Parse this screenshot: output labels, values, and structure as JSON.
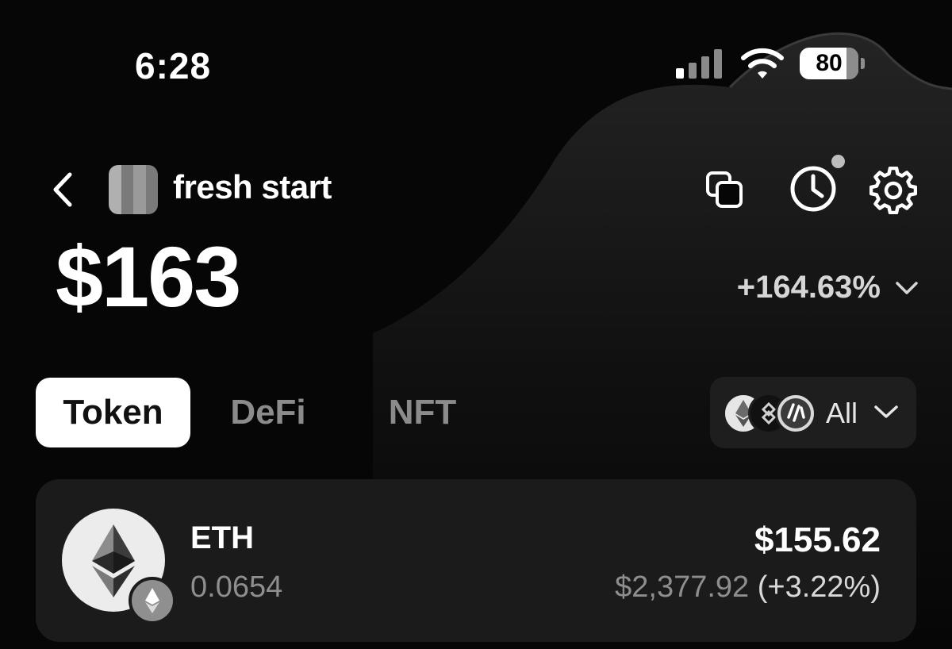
{
  "status_bar": {
    "time": "6:28",
    "battery_level": "80",
    "battery_fraction": 0.8,
    "signal_icon": "cellular-signal-icon",
    "wifi_icon": "wifi-icon",
    "battery_icon": "battery-icon"
  },
  "header": {
    "back_icon": "chevron-left-icon",
    "avatar_icon": "pixelated-avatar",
    "wallet_name": "fresh start",
    "actions": [
      {
        "name": "copy-icon"
      },
      {
        "name": "clock-history-icon",
        "has_notification_dot": true
      },
      {
        "name": "gear-icon"
      }
    ]
  },
  "portfolio": {
    "balance": "$163",
    "change": "+164.63%",
    "change_dropdown_icon": "chevron-down-icon"
  },
  "tabs": [
    {
      "label": "Token",
      "active": true
    },
    {
      "label": "DeFi",
      "active": false
    },
    {
      "label": "NFT",
      "active": false
    }
  ],
  "chain_filter": {
    "label": "All",
    "chain_icons": [
      "ethereum-icon",
      "bnb-icon",
      "arbitrum-icon"
    ],
    "dropdown_icon": "chevron-down-icon"
  },
  "tokens": [
    {
      "symbol": "ETH",
      "amount": "0.0654",
      "value": "$155.62",
      "price": "$2,377.92",
      "change": "(+3.22%)",
      "icon": "ethereum-icon",
      "network_badge_icon": "ethereum-icon"
    }
  ],
  "colors": {
    "background": "#060606",
    "card": "#1b1b1b",
    "active_tab": "#ffffff",
    "muted_text": "#8e8e8e"
  }
}
